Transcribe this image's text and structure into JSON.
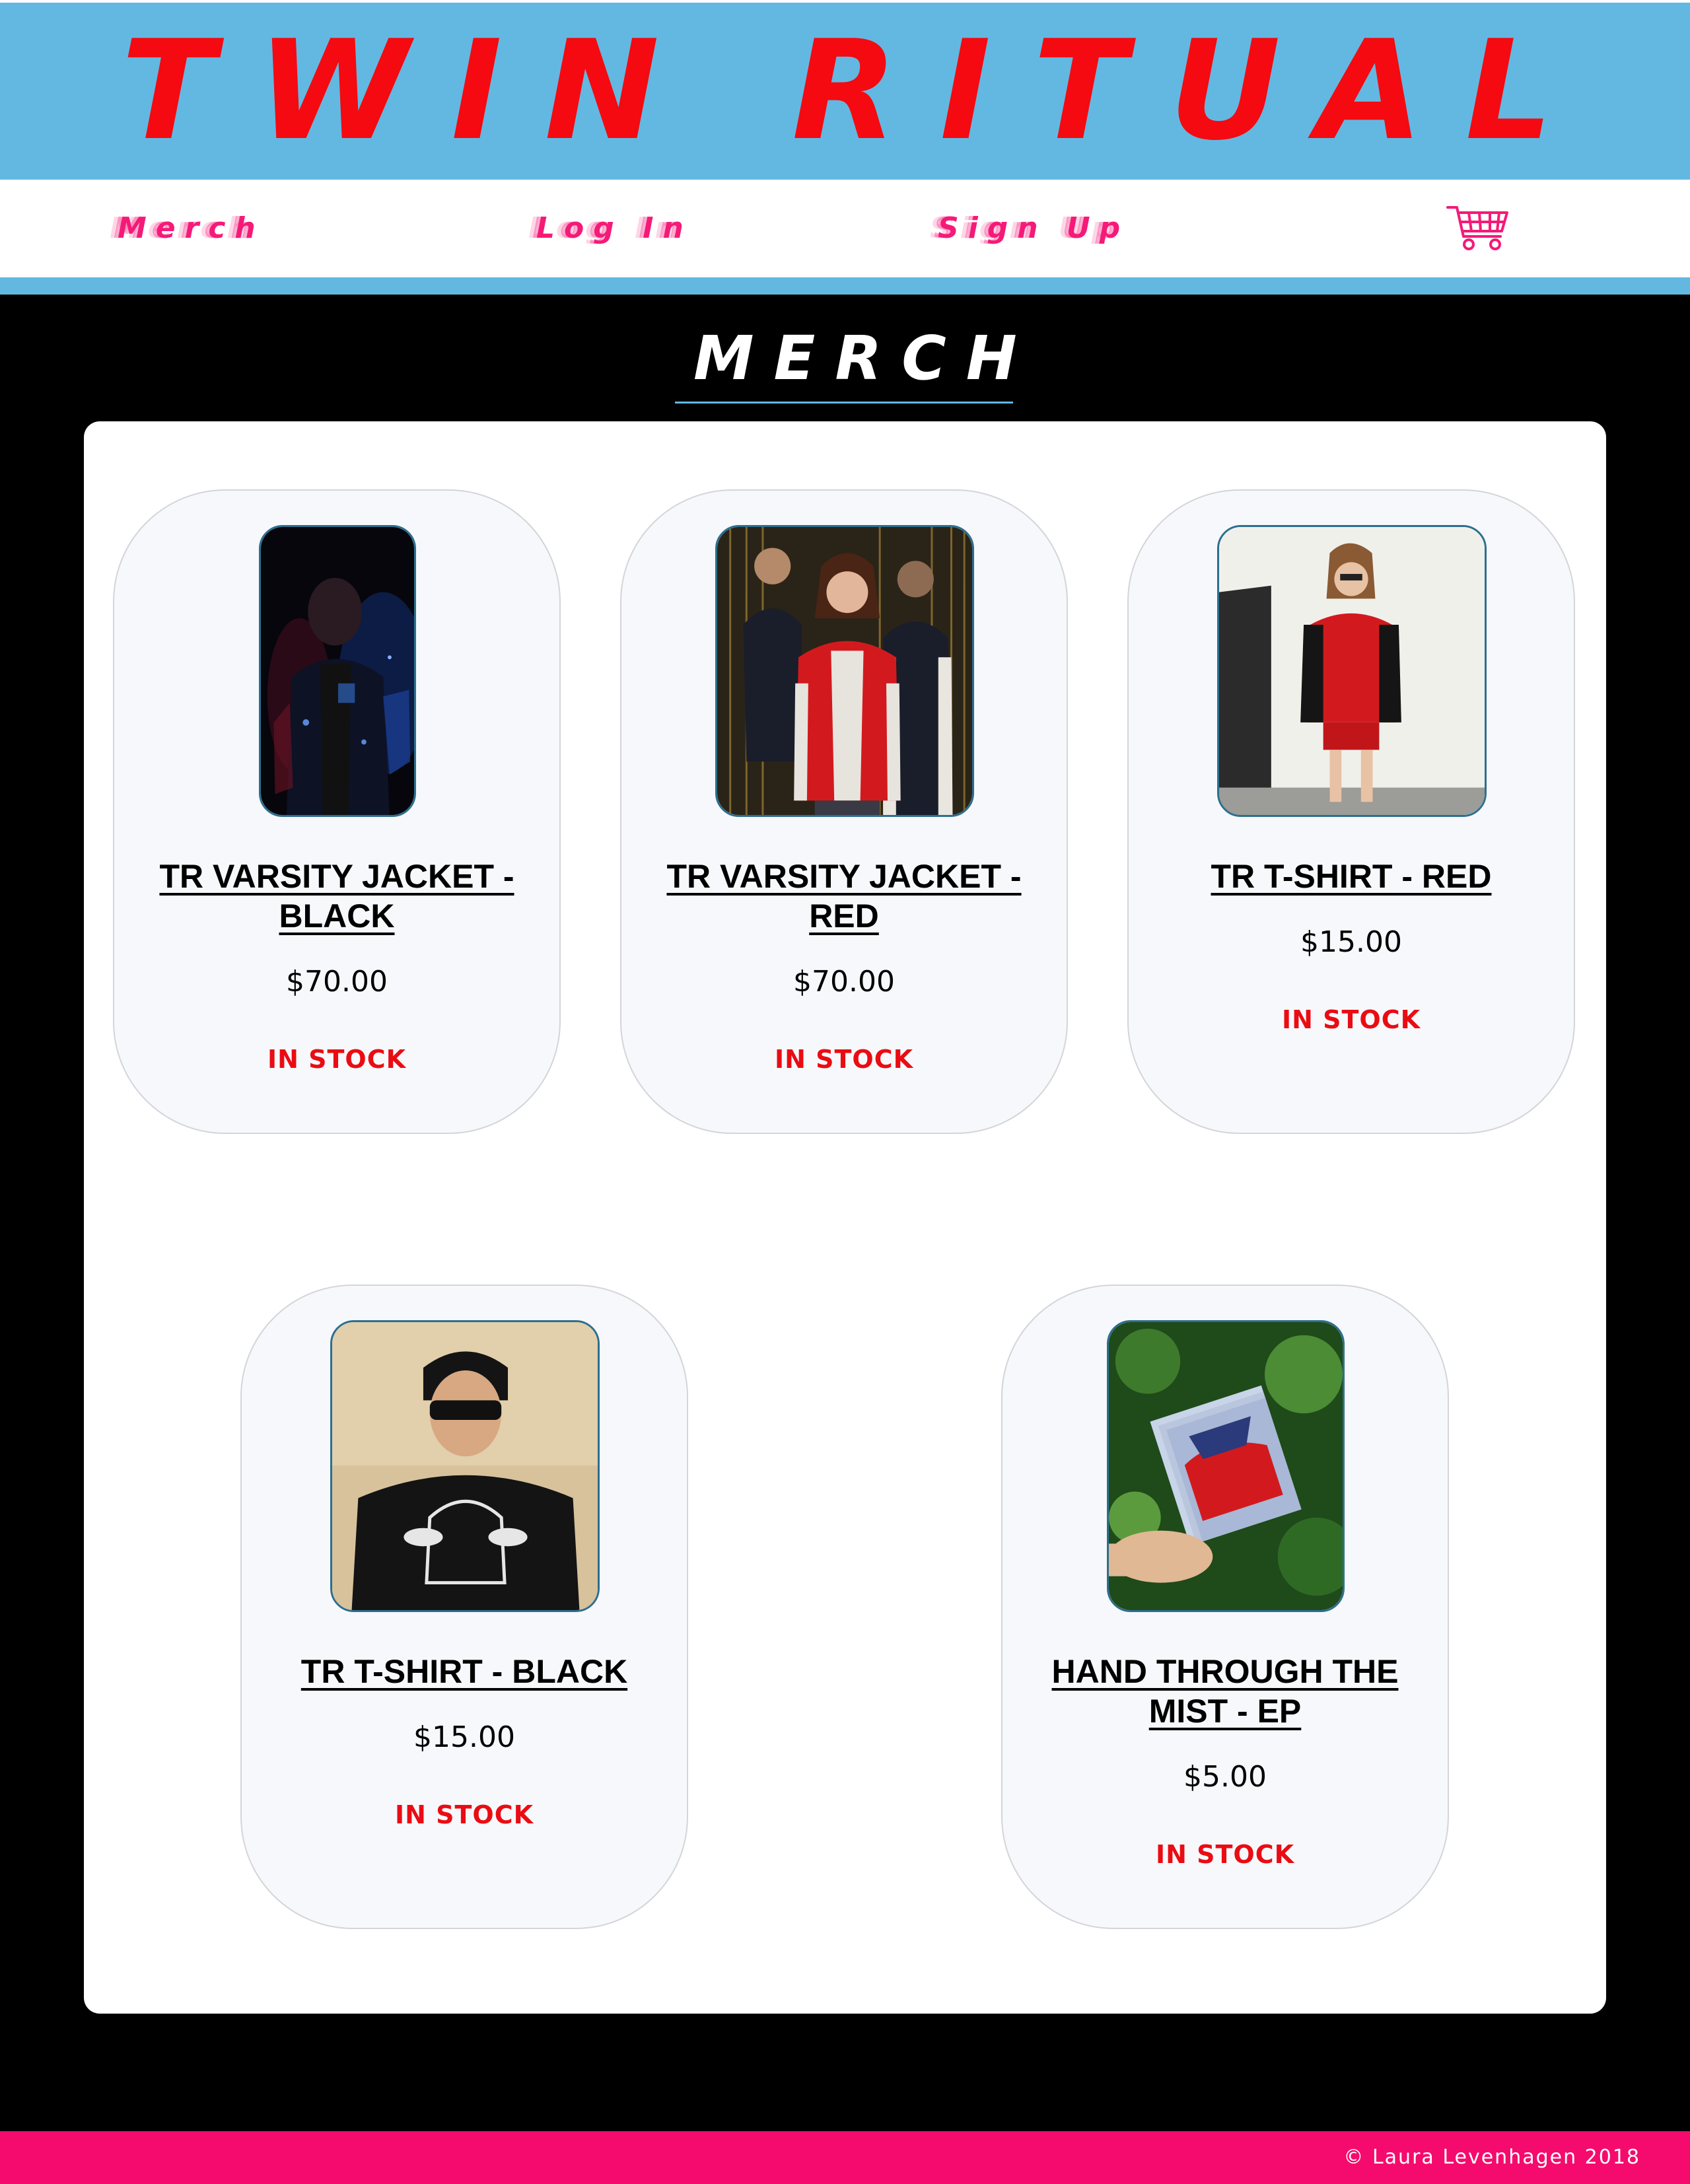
{
  "site": {
    "title": "TWIN RITUAL"
  },
  "nav": {
    "merch": "Merch",
    "login": "Log In",
    "signup": "Sign Up",
    "cart_icon": "shopping-cart-icon"
  },
  "page": {
    "heading": "MERCH"
  },
  "products": [
    {
      "title": "TR VARSITY JACKET - BLACK",
      "price": "$70.00",
      "stock": "IN STOCK"
    },
    {
      "title": "TR VARSITY JACKET - RED",
      "price": "$70.00",
      "stock": "IN STOCK"
    },
    {
      "title": "TR T-SHIRT - RED",
      "price": "$15.00",
      "stock": "IN STOCK"
    },
    {
      "title": "TR T-SHIRT - BLACK",
      "price": "$15.00",
      "stock": "IN STOCK"
    },
    {
      "title": "HAND THROUGH THE MIST - EP",
      "price": "$5.00",
      "stock": "IN STOCK"
    }
  ],
  "footer": {
    "copyright": "© Laura Levenhagen 2018"
  },
  "colors": {
    "banner": "#63b8e2",
    "title_red": "#f40a10",
    "nav_pink": "#f51a78",
    "stock_red": "#ea0c13",
    "footer_pink": "#f50b6e"
  }
}
